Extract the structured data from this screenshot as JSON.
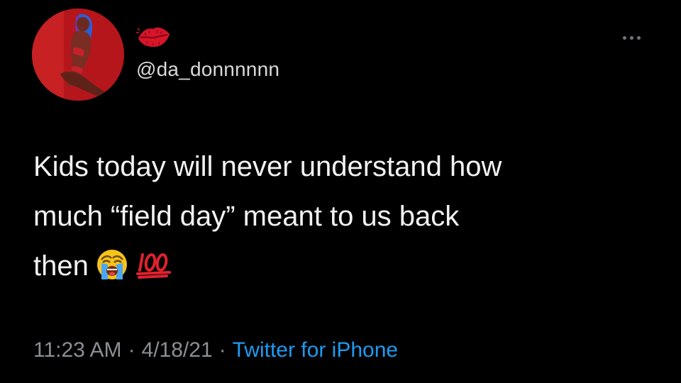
{
  "tweet": {
    "handle": "@da_donnnnnn",
    "text_lines": [
      "Kids today will never understand how",
      "much “field day” meant to us back",
      "then"
    ],
    "emojis": [
      "loudly-crying-face-icon",
      "hundred-points-icon"
    ],
    "time": "11:23 AM",
    "date": "4/18/21",
    "separator": "·",
    "source": "Twitter for iPhone"
  },
  "icons": {
    "display_name": "lips-icon",
    "more": "more-options-icon"
  },
  "colors": {
    "background": "#000000",
    "text": "#f2f2f2",
    "secondary": "#8b8f94",
    "link": "#1d9bf0"
  }
}
